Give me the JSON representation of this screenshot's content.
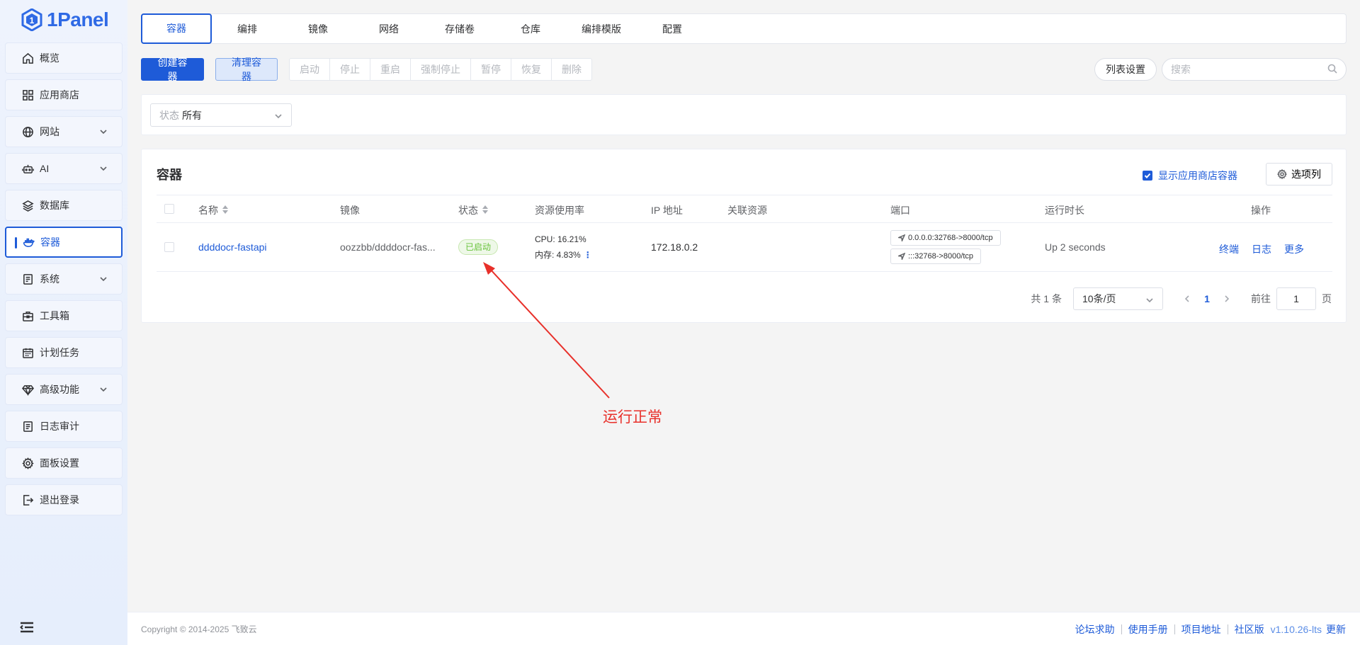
{
  "brand": {
    "name": "1Panel"
  },
  "sidebar": {
    "items": [
      {
        "label": "概览",
        "icon": "home-icon",
        "expandable": false
      },
      {
        "label": "应用商店",
        "icon": "grid-icon",
        "expandable": false
      },
      {
        "label": "网站",
        "icon": "globe-icon",
        "expandable": true
      },
      {
        "label": "AI",
        "icon": "robot-icon",
        "expandable": true
      },
      {
        "label": "数据库",
        "icon": "layers-icon",
        "expandable": false
      },
      {
        "label": "容器",
        "icon": "docker-icon",
        "expandable": false,
        "active": true
      },
      {
        "label": "系统",
        "icon": "server-icon",
        "expandable": true
      },
      {
        "label": "工具箱",
        "icon": "toolbox-icon",
        "expandable": false
      },
      {
        "label": "计划任务",
        "icon": "calendar-icon",
        "expandable": false
      },
      {
        "label": "高级功能",
        "icon": "diamond-icon",
        "expandable": true
      },
      {
        "label": "日志审计",
        "icon": "log-icon",
        "expandable": false
      },
      {
        "label": "面板设置",
        "icon": "gear-icon",
        "expandable": false
      },
      {
        "label": "退出登录",
        "icon": "logout-icon",
        "expandable": false
      }
    ]
  },
  "tabs": [
    "容器",
    "编排",
    "镜像",
    "网络",
    "存储卷",
    "仓库",
    "编排模版",
    "配置"
  ],
  "toolbar": {
    "create": "创建容器",
    "clean": "清理容器",
    "group": [
      "启动",
      "停止",
      "重启",
      "强制停止",
      "暂停",
      "恢复",
      "删除"
    ],
    "list_settings": "列表设置",
    "search_placeholder": "搜索"
  },
  "filter": {
    "status_prefix": "状态",
    "status_value": "所有"
  },
  "card": {
    "title": "容器",
    "show_appstore": "显示应用商店容器",
    "columns_button": "选项列"
  },
  "table": {
    "headers": {
      "name": "名称",
      "image": "镜像",
      "status": "状态",
      "resource": "资源使用率",
      "ip": "IP 地址",
      "related": "关联资源",
      "port": "端口",
      "uptime": "运行时长",
      "actions": "操作"
    },
    "rows": [
      {
        "name": "ddddocr-fastapi",
        "image": "oozzbb/ddddocr-fas...",
        "status": "已启动",
        "cpu": "CPU: 16.21%",
        "mem": "内存: 4.83%",
        "ip": "172.18.0.2",
        "ports": [
          "0.0.0.0:32768->8000/tcp",
          ":::32768->8000/tcp"
        ],
        "uptime": "Up 2 seconds",
        "actions": [
          "终端",
          "日志",
          "更多"
        ]
      }
    ]
  },
  "pager": {
    "total": "共 1 条",
    "size": "10条/页",
    "current": "1",
    "goto_label": "前往",
    "goto_value": "1",
    "unit": "页"
  },
  "annotation": {
    "text": "运行正常",
    "color": "#e8302a"
  },
  "footer": {
    "copyright": "Copyright © 2014-2025 飞致云",
    "links": [
      "论坛求助",
      "使用手册",
      "项目地址",
      "社区版"
    ],
    "version": "v1.10.26-lts",
    "update": "更新"
  },
  "colors": {
    "accent": "#1e5bd8",
    "success": "#67c23a",
    "annotation": "#e8302a"
  }
}
